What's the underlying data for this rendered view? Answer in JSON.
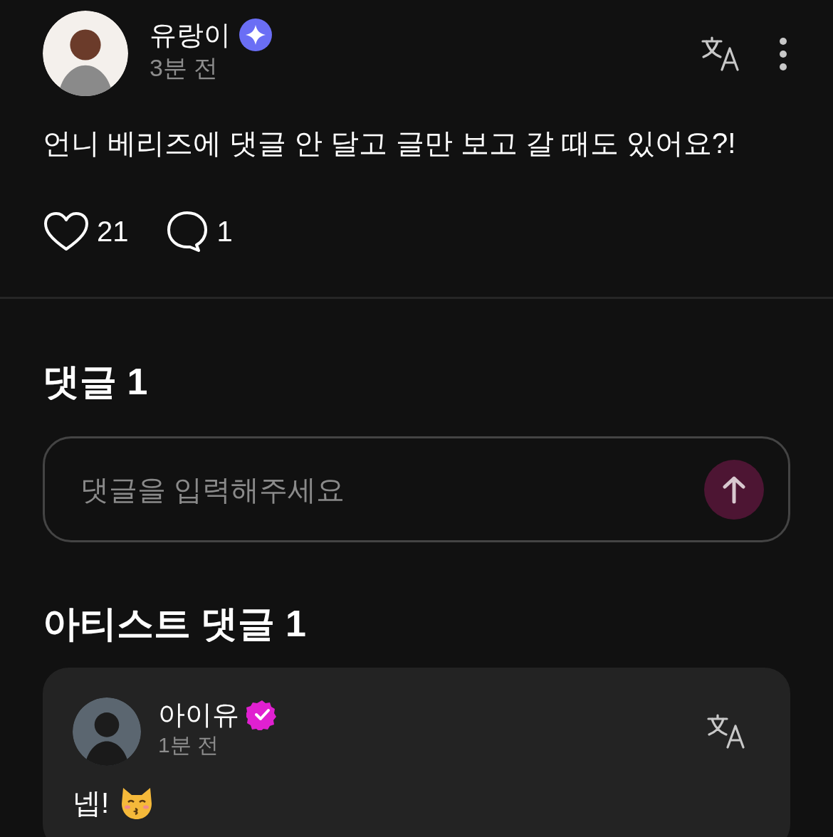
{
  "post": {
    "author": "유랑이",
    "verified": true,
    "time": "3분 전",
    "text": "언니 베리즈에 댓글 안 달고 글만 보고 갈 때도 있어요?!",
    "likes": "21",
    "liked": false,
    "comments": "1"
  },
  "comments_section": {
    "title": "댓글 1",
    "input": {
      "placeholder": "댓글을 입력해주세요"
    },
    "send": {
      "disabled": true
    }
  },
  "artist_section": {
    "title": "아티스트 댓글 1",
    "comments": [
      {
        "author": "아이유",
        "verified": true,
        "time": "1분 전",
        "text": "넵!"
      }
    ]
  }
}
